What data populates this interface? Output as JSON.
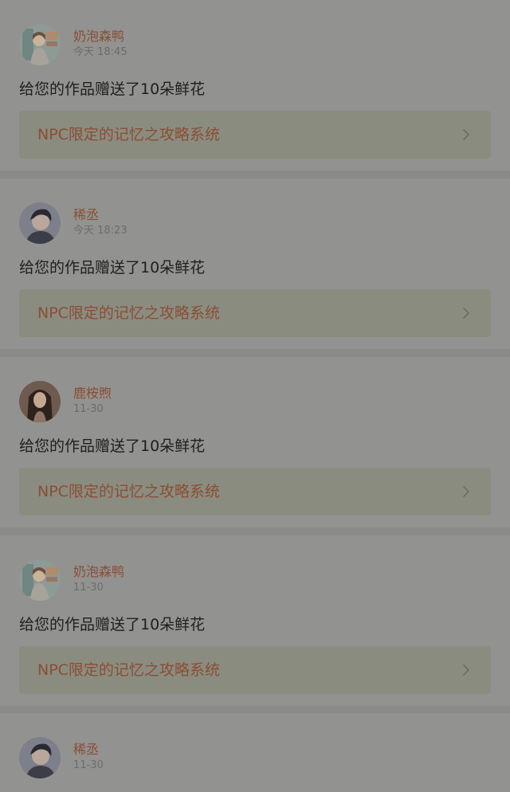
{
  "notifications": [
    {
      "avatar": "girl-illustration-avatar",
      "name": "奶泡森鸭",
      "time": "今天 18:45",
      "message": "给您的作品赠送了10朵鲜花",
      "work_title": "NPC限定的记忆之攻略系统"
    },
    {
      "avatar": "young-man-photo-avatar",
      "name": "稀丞",
      "time": "今天 18:23",
      "message": "给您的作品赠送了10朵鲜花",
      "work_title": "NPC限定的记忆之攻略系统"
    },
    {
      "avatar": "woman-long-hair-avatar",
      "name": "鹿桉煦",
      "time": "11-30",
      "message": "给您的作品赠送了10朵鲜花",
      "work_title": "NPC限定的记忆之攻略系统"
    },
    {
      "avatar": "girl-illustration-avatar",
      "name": "奶泡森鸭",
      "time": "11-30",
      "message": "给您的作品赠送了10朵鲜花",
      "work_title": "NPC限定的记忆之攻略系统"
    },
    {
      "avatar": "young-man-photo-avatar",
      "name": "稀丞",
      "time": "11-30",
      "message": "",
      "work_title": ""
    }
  ]
}
